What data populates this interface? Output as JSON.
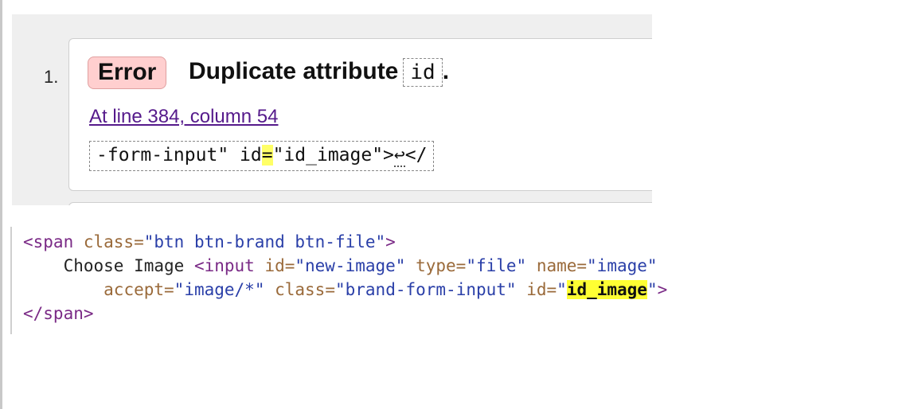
{
  "error_item": {
    "number": "1.",
    "badge": "Error",
    "message_prefix": "Duplicate attribute",
    "message_code": "id",
    "message_suffix": ".",
    "location_link": "At line 384, column 54",
    "extract_before": "-form-input\" id",
    "extract_highlight": "=",
    "extract_after": "\"id_image\">",
    "extract_linefeed": "↩",
    "extract_end": "</"
  },
  "source": {
    "line1": {
      "open": "<span",
      "attr": " class=",
      "val": "\"btn btn-brand btn-file\"",
      "close": ">"
    },
    "line2": {
      "text": "    Choose Image ",
      "tag": "<input",
      "attr1": " id=",
      "val1": "\"new-image\"",
      "attr2": " type=",
      "val2": "\"file\"",
      "attr3": " name=",
      "val3": "\"image\""
    },
    "line3": {
      "indent": "        ",
      "attr1": "accept=",
      "val1": "\"image/*\"",
      "attr2": " class=",
      "val2": "\"brand-form-input\"",
      "attr3": " id=",
      "quote_open": "\"",
      "highlight": "id_image",
      "quote_close": "\"",
      "close": ">"
    },
    "line4": {
      "close_tag": "</span>"
    }
  }
}
